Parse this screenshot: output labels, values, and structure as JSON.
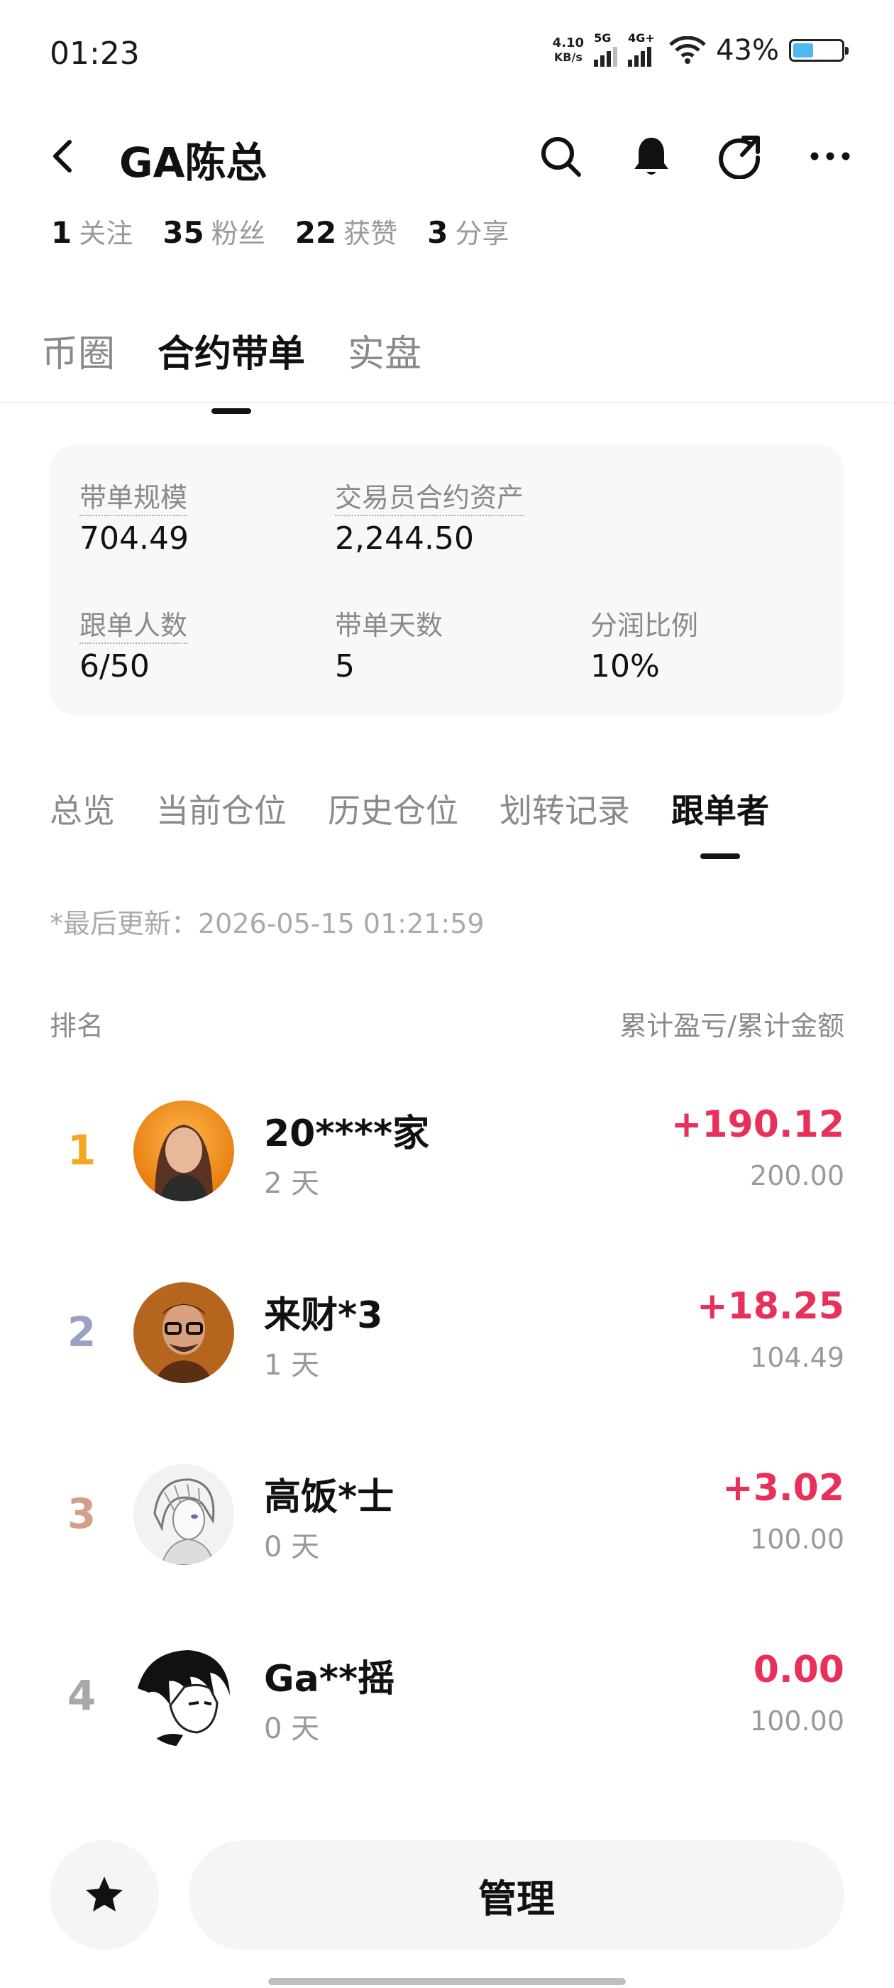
{
  "status_bar": {
    "time": "01:23",
    "net_speed_value": "4.10",
    "net_speed_unit": "KB/s",
    "sim1_label": "5G",
    "sim2_label": "4G+",
    "battery_percent": "43%",
    "battery_level": 0.43
  },
  "header": {
    "title": "GA陈总"
  },
  "profile_stats": [
    {
      "num": "1",
      "label": "关注"
    },
    {
      "num": "35",
      "label": "粉丝"
    },
    {
      "num": "22",
      "label": "获赞"
    },
    {
      "num": "3",
      "label": "分享"
    }
  ],
  "main_tabs": [
    {
      "label": "币圈",
      "active": false
    },
    {
      "label": "合约带单",
      "active": true
    },
    {
      "label": "实盘",
      "active": false
    }
  ],
  "info_card": {
    "scale_label": "带单规模",
    "scale_value": "704.49",
    "assets_label": "交易员合约资产",
    "assets_value": "2,244.50",
    "followers_label": "跟单人数",
    "followers_value": "6/50",
    "days_label": "带单天数",
    "days_value": "5",
    "share_label": "分润比例",
    "share_value": "10%"
  },
  "sub_tabs": [
    {
      "label": "总览",
      "active": false
    },
    {
      "label": "当前仓位",
      "active": false
    },
    {
      "label": "历史仓位",
      "active": false
    },
    {
      "label": "划转记录",
      "active": false
    },
    {
      "label": "跟单者",
      "active": true
    }
  ],
  "last_update": "*最后更新：2026-05-15 01:21:59",
  "list_header": {
    "left": "排名",
    "right": "累计盈亏/累计金额"
  },
  "followers": [
    {
      "rank": "1",
      "name": "20****家",
      "days": "2 天",
      "pnl": "+190.12",
      "amount": "200.00",
      "rank_color": "#f5a623"
    },
    {
      "rank": "2",
      "name": "来财*3",
      "days": "1 天",
      "pnl": "+18.25",
      "amount": "104.49",
      "rank_color": "#9aa0c0"
    },
    {
      "rank": "3",
      "name": "高饭*士",
      "days": "0 天",
      "pnl": "+3.02",
      "amount": "100.00",
      "rank_color": "#d2a08a"
    },
    {
      "rank": "4",
      "name": "Ga**摇",
      "days": "0 天",
      "pnl": "0.00",
      "amount": "100.00",
      "rank_color": "#a8a8a8"
    }
  ],
  "bottom_bar": {
    "manage_label": "管理"
  },
  "colors": {
    "profit": "#e8305a",
    "accent_dark": "#111111",
    "muted": "#8a8a8a"
  }
}
